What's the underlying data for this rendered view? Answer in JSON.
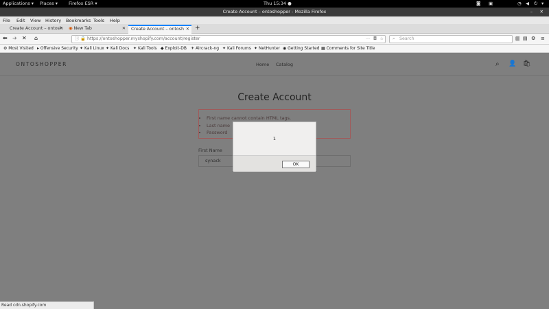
{
  "system_bar": {
    "applications": "Applications ▾",
    "places": "Places ▾",
    "firefox": "Firefox ESR ▾",
    "clock": "Thu 15:34 ●"
  },
  "window_title": "Create Account – ontoshopper - Mozilla Firefox",
  "menu": [
    "File",
    "Edit",
    "View",
    "History",
    "Bookmarks",
    "Tools",
    "Help"
  ],
  "tabs": [
    {
      "label": "Create Account – ontosh",
      "active": false
    },
    {
      "label": "New Tab",
      "active": false
    },
    {
      "label": "Create Account – ontosh",
      "active": true
    }
  ],
  "new_tab_symbol": "+",
  "url": "https://ontoshopper.myshopify.com/account/register",
  "search_placeholder": "Search",
  "bookmarks": [
    "Most Visited",
    "Offensive Security",
    "Kali Linux",
    "Kali Docs",
    "Kali Tools",
    "Exploit-DB",
    "Aircrack-ng",
    "Kali Forums",
    "NetHunter",
    "Getting Started",
    "Comments for Site Title"
  ],
  "site": {
    "logo": "ONTOSHOPPER",
    "nav": [
      "Home",
      "Catalog"
    ]
  },
  "page_title": "Create Account",
  "errors": [
    "First name cannot contain HTML tags.",
    "Last name",
    "Password"
  ],
  "first_name_label": "First Name",
  "first_name_value": "synack",
  "dialog": {
    "message": "1",
    "ok": "OK"
  },
  "status": "Read cdn.shopify.com",
  "colors": {
    "overlay": "#7f7f7f",
    "tab_accent": "#0a84ff",
    "error_border": "#a05a5a"
  }
}
